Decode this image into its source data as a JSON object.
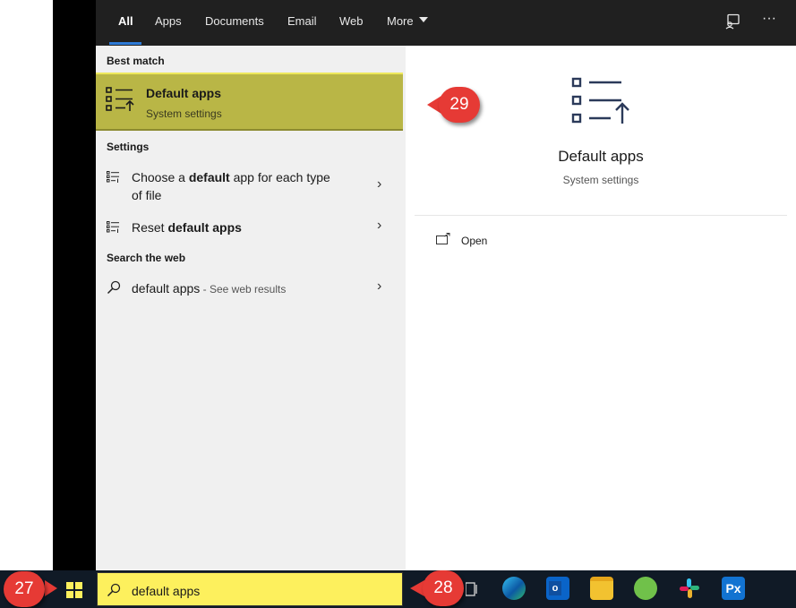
{
  "tabs": [
    {
      "label": "All"
    },
    {
      "label": "Apps"
    },
    {
      "label": "Documents"
    },
    {
      "label": "Email"
    },
    {
      "label": "Web"
    },
    {
      "label": "More"
    }
  ],
  "toolbar": {
    "feedback_icon": "feedback-icon",
    "more_options": "···"
  },
  "results": {
    "best_match_header": "Best match",
    "best_match": {
      "title": "Default apps",
      "subtitle": "System settings"
    },
    "settings_header": "Settings",
    "settings": [
      {
        "pre": "Choose a ",
        "bold": "default",
        "post": " app for each type",
        "line2": "of file"
      },
      {
        "pre": "Reset ",
        "bold": "default apps",
        "post": "",
        "line2": ""
      }
    ],
    "web_header": "Search the web",
    "web": {
      "query": "default apps",
      "suffix": " - See web results"
    }
  },
  "preview": {
    "title": "Default apps",
    "subtitle": "System settings",
    "open_label": "Open"
  },
  "search": {
    "value": "default apps"
  },
  "callouts": [
    "27",
    "28",
    "29"
  ],
  "colors": {
    "highlight": "#b9b646",
    "search_highlight": "#fdf05d",
    "callout": "#e63a35",
    "accent": "#2d7ad6"
  }
}
